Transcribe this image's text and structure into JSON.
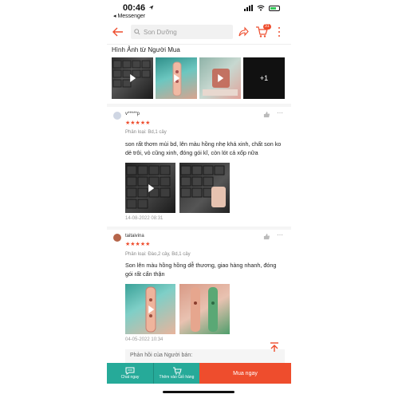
{
  "statusbar": {
    "time": "00:46",
    "back_app": "◂ Messenger"
  },
  "header": {
    "search_placeholder": "Son Dưỡng",
    "cart_count": "31"
  },
  "gallery": {
    "title": "Hình Ảnh từ Người Mua",
    "more_label": "+1"
  },
  "reviews": [
    {
      "user": "v*****p",
      "stars": "★★★★★",
      "variant": "Phân loại: Bd,1 cây",
      "text": "son rất thơm mùi bd, lên màu hồng nhẹ khá xinh, chất son ko dẻ trôi, vỏ cũng xinh, đóng gói kĩ, còn lót cả xốp nữa",
      "date": "14-08-2022 08:31"
    },
    {
      "user": "taitaivina",
      "stars": "★★★★★",
      "variant": "Phân loại: Đào,2 cây, Bd,1 cây",
      "text": "Son lên màu hồng hồng dễ thương, giao hàng nhanh, đóng gói rất cẩn thận",
      "date": "04-05-2022 10:34"
    }
  ],
  "seller_reply": {
    "label": "Phản hồi của Người bán:"
  },
  "bottombar": {
    "chat_label": "Chat ngay",
    "cart_label": "Thêm vào Giỏ hàng",
    "buy_label": "Mua ngay"
  },
  "colors": {
    "accent": "#ee4d2d",
    "teal": "#26aa99"
  }
}
